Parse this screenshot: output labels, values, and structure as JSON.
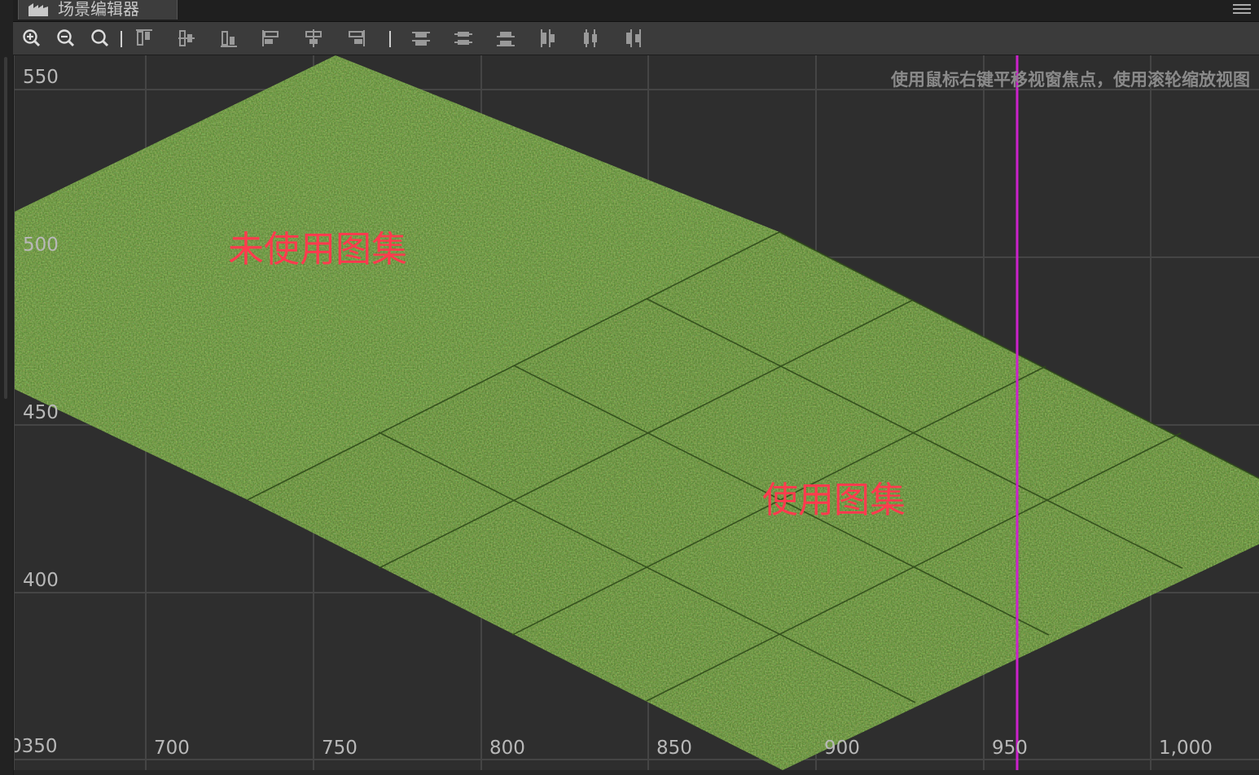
{
  "window": {
    "tab_title": "场景编辑器",
    "menu_icon": "hamburger-icon"
  },
  "toolbar": {
    "zoom": [
      {
        "name": "zoom-in",
        "icon": "zoom-in-icon"
      },
      {
        "name": "zoom-out",
        "icon": "zoom-out-icon"
      },
      {
        "name": "zoom-reset",
        "icon": "zoom-fit-icon"
      }
    ],
    "align": [
      {
        "name": "align-top",
        "icon": "align-top-icon"
      },
      {
        "name": "align-vcenter",
        "icon": "align-vcenter-icon"
      },
      {
        "name": "align-bottom",
        "icon": "align-bottom-icon"
      },
      {
        "name": "align-left",
        "icon": "align-left-icon"
      },
      {
        "name": "align-hcenter",
        "icon": "align-hcenter-icon"
      },
      {
        "name": "align-right",
        "icon": "align-right-icon"
      }
    ],
    "distribute": [
      {
        "name": "distribute-top",
        "icon": "distribute-top-icon"
      },
      {
        "name": "distribute-vcenter",
        "icon": "distribute-vcenter-icon"
      },
      {
        "name": "distribute-bottom",
        "icon": "distribute-bottom-icon"
      },
      {
        "name": "distribute-left",
        "icon": "distribute-left-icon"
      },
      {
        "name": "distribute-hcenter",
        "icon": "distribute-hcenter-icon"
      },
      {
        "name": "distribute-right",
        "icon": "distribute-right-icon"
      }
    ]
  },
  "scene": {
    "hint": "使用鼠标右键平移视窗焦点，使用滚轮缩放视图",
    "y_axis_labels": [
      "550",
      "500",
      "450",
      "400",
      "0350"
    ],
    "x_axis_labels": [
      "700",
      "750",
      "800",
      "850",
      "900",
      "950",
      "1,000"
    ],
    "labels": {
      "unused_atlas": "未使用图集",
      "used_atlas": "使用图集"
    },
    "colors": {
      "background": "#2e2e2e",
      "grid": "#454545",
      "grass": "#4e7a2c",
      "guide_line": "#cc22cc",
      "label": "#ff3b4e"
    }
  }
}
